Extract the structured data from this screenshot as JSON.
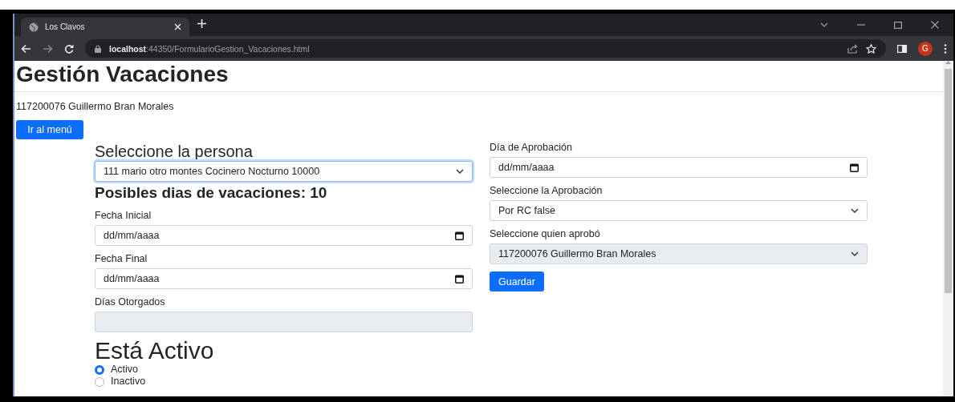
{
  "browser": {
    "tab": {
      "title": "Los Clavos"
    },
    "url": {
      "host": "localhost",
      "path": ":44350/FormularioGestion_Vacaciones.html"
    },
    "profile_initial": "G"
  },
  "page": {
    "title": "Gestión Vacaciones",
    "user": "117200076 Guillermo Bran Morales",
    "menu_button": "Ir al menú",
    "left_column": [
      {
        "kind": "heading",
        "text": "Seleccione la persona"
      },
      {
        "kind": "select",
        "value": "111 mario otro montes Cocinero Nocturno 10000",
        "focused": true,
        "disabled": false
      },
      {
        "kind": "heading_bold",
        "text": "Posibles dias de vacaciones: 10"
      },
      {
        "kind": "date",
        "label": "Fecha Inicial",
        "placeholder": "dd/mm/aaaa",
        "focused": false,
        "disabled": false
      },
      {
        "kind": "date",
        "label": "Fecha Final",
        "placeholder": "dd/mm/aaaa",
        "focused": false,
        "disabled": false
      },
      {
        "kind": "text",
        "label": "Días Otorgados",
        "focused": false,
        "disabled": true
      },
      {
        "kind": "heading_large",
        "text": "Está Activo"
      },
      {
        "kind": "radio",
        "options": [
          {
            "label": "Activo",
            "selected": true
          },
          {
            "label": "Inactivo",
            "selected": false
          }
        ]
      }
    ],
    "right_column": [
      {
        "kind": "date",
        "label": "Día de Aprobación",
        "placeholder": "dd/mm/aaaa",
        "focused": false,
        "disabled": false
      },
      {
        "kind": "select",
        "label": "Seleccione la Aprobación",
        "value": "Por RC false",
        "focused": false,
        "disabled": false
      },
      {
        "kind": "select",
        "label": "Seleccione quien aprobó",
        "value": "117200076 Guillermo Bran Morales",
        "focused": false,
        "disabled": true
      },
      {
        "kind": "button",
        "label": "Guardar"
      }
    ]
  }
}
